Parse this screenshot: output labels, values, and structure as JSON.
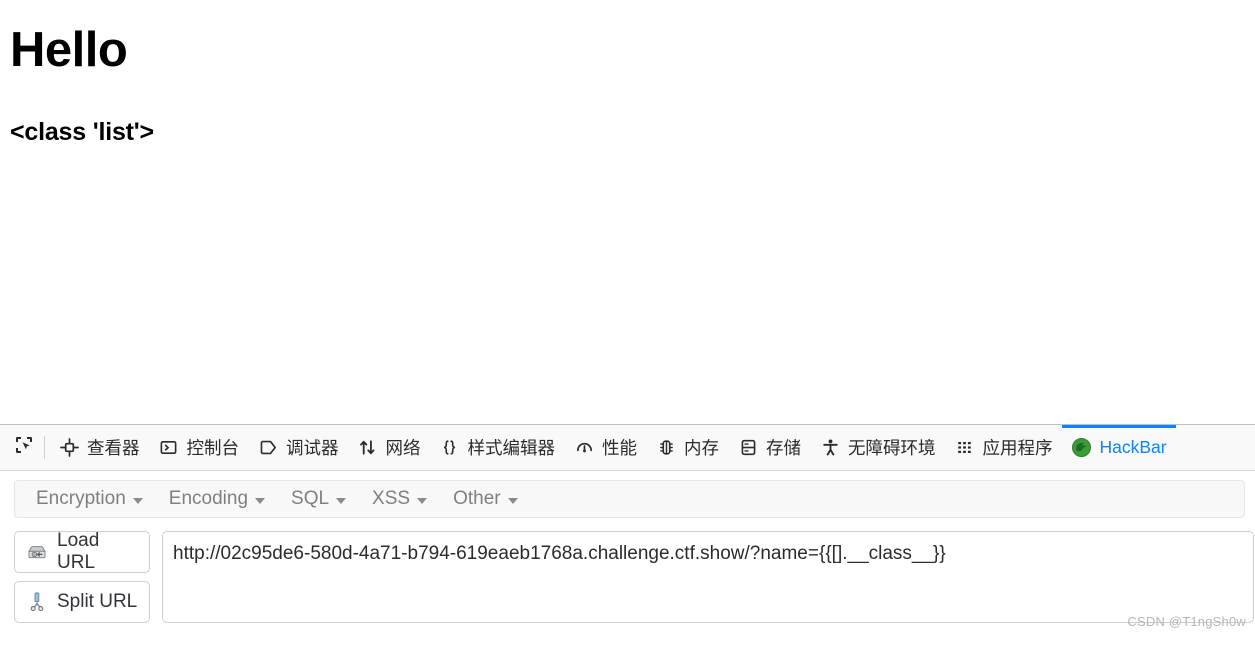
{
  "page": {
    "title": "Hello",
    "subtitle": "<class 'list'>"
  },
  "devtools": {
    "picker_icon": "element-picker-icon",
    "tabs": [
      {
        "label": "查看器",
        "icon": "inspector-icon",
        "selected": false
      },
      {
        "label": "控制台",
        "icon": "console-icon",
        "selected": false
      },
      {
        "label": "调试器",
        "icon": "debugger-icon",
        "selected": false
      },
      {
        "label": "网络",
        "icon": "network-icon",
        "selected": false
      },
      {
        "label": "样式编辑器",
        "icon": "style-editor-icon",
        "selected": false
      },
      {
        "label": "性能",
        "icon": "performance-icon",
        "selected": false
      },
      {
        "label": "内存",
        "icon": "memory-icon",
        "selected": false
      },
      {
        "label": "存储",
        "icon": "storage-icon",
        "selected": false
      },
      {
        "label": "无障碍环境",
        "icon": "accessibility-icon",
        "selected": false
      },
      {
        "label": "应用程序",
        "icon": "application-grid-icon",
        "selected": false
      },
      {
        "label": "HackBar",
        "icon": "hackbar-logo-icon",
        "selected": true
      }
    ],
    "selected_tab_color": "#0a84ff"
  },
  "hackbar": {
    "menus": [
      {
        "label": "Encryption"
      },
      {
        "label": "Encoding"
      },
      {
        "label": "SQL"
      },
      {
        "label": "XSS"
      },
      {
        "label": "Other"
      }
    ],
    "buttons": [
      {
        "label": "Load URL",
        "icon": "load-url-disk-icon"
      },
      {
        "label": "Split URL",
        "icon": "split-url-scissors-icon"
      }
    ],
    "url_value": "http://02c95de6-580d-4a71-b794-619eaeb1768a.challenge.ctf.show/?name={{[].__class__}}",
    "url_placeholder": "URL"
  },
  "watermark": "CSDN @T1ngSh0w"
}
